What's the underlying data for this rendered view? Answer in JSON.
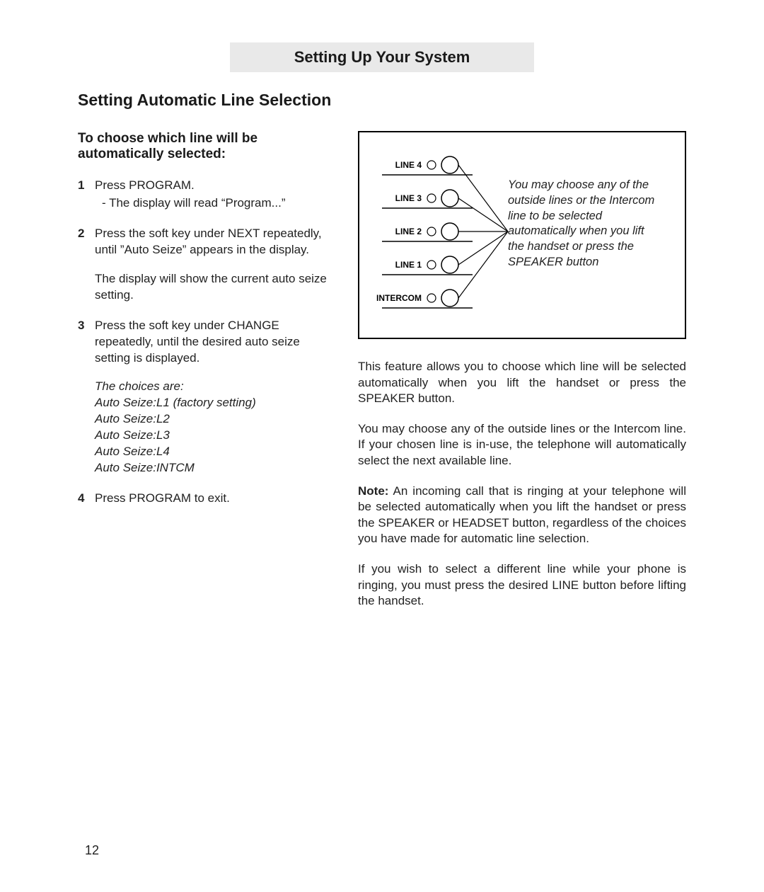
{
  "header": "Setting Up Your System",
  "section_title": "Setting Automatic Line Selection",
  "left": {
    "subheading": "To choose which line will be automatically selected:",
    "steps": [
      {
        "num": "1",
        "main": "Press PROGRAM.",
        "sub": "- The display will read “Program...”",
        "note": "",
        "choices_intro": "",
        "choices": []
      },
      {
        "num": "2",
        "main": "Press the soft key under NEXT repeatedly, until ”Auto Seize” appears in the display.",
        "sub": "",
        "note": "The display will show the current auto seize setting.",
        "choices_intro": "",
        "choices": []
      },
      {
        "num": "3",
        "main": "Press the soft key under CHANGE repeatedly, until the desired auto seize setting is displayed.",
        "sub": "",
        "note": "",
        "choices_intro": "The choices are:",
        "choices": [
          "Auto Seize:L1 (factory setting)",
          "Auto Seize:L2",
          "Auto Seize:L3",
          "Auto Seize:L4",
          "Auto Seize:INTCM"
        ]
      },
      {
        "num": "4",
        "main": "Press PROGRAM to exit.",
        "sub": "",
        "note": "",
        "choices_intro": "",
        "choices": []
      }
    ]
  },
  "diagram": {
    "rows": [
      "LINE 4",
      "LINE 3",
      "LINE 2",
      "LINE 1",
      "INTERCOM"
    ],
    "caption": "You may choose any of the outside lines or the Intercom line to be selected automatically when you lift the handset or press the SPEAK­ER button"
  },
  "right_paras": {
    "p1": "This feature allows you to choose which line will be selected automatically when you lift the hand­set or press the SPEAKER button.",
    "p2": "You may choose any of the outside lines or the Intercom line.  If your chosen line is in-use, the telephone will automatically select the next avail­able line.",
    "p3_bold": "Note:",
    "p3_rest": "  An incoming call that is ringing at your telephone will be selected automatically when you lift the handset or press the SPEAKER or HEADSET button, regardless of the choices you have made for automatic line selection.",
    "p4": "If you wish to select a different line while your phone is ringing, you must press the desired LINE button before lifting the handset."
  },
  "page_number": "12"
}
